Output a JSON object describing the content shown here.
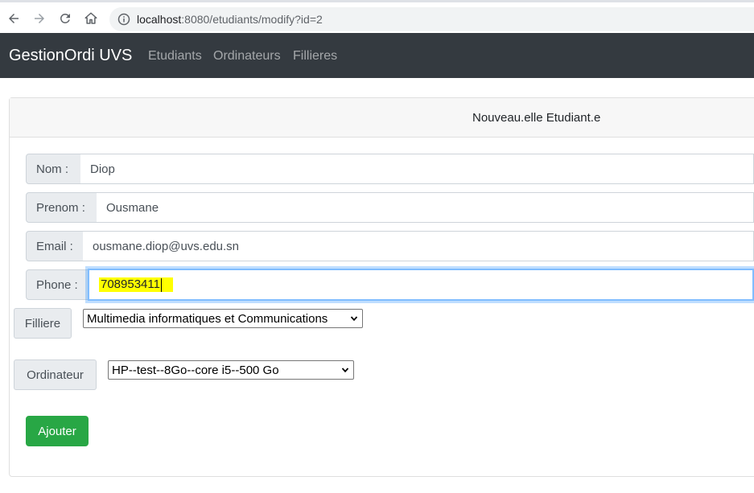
{
  "browser": {
    "url_host": "localhost",
    "url_path": ":8080/etudiants/modify?id=2"
  },
  "navbar": {
    "brand": "GestionOrdi UVS",
    "links": [
      "Etudiants",
      "Ordinateurs",
      "Fillieres"
    ]
  },
  "card": {
    "title": "Nouveau.elle Etudiant.e"
  },
  "form": {
    "nom_label": "Nom :",
    "nom_value": "Diop",
    "prenom_label": "Prenom :",
    "prenom_value": "Ousmane",
    "email_label": "Email :",
    "email_value": "ousmane.diop@uvs.edu.sn",
    "phone_label": "Phone :",
    "phone_value": "708953411",
    "filliere_label": "Filliere",
    "filliere_selected": "Multimedia informatiques et Communications",
    "ordinateur_label": "Ordinateur",
    "ordinateur_selected": "HP--test--8Go--core i5--500 Go",
    "submit_label": "Ajouter"
  },
  "colors": {
    "navbar_bg": "#343a40",
    "submit_bg": "#28a745",
    "highlight": "#ffff00",
    "focus_border": "#80bdff"
  }
}
